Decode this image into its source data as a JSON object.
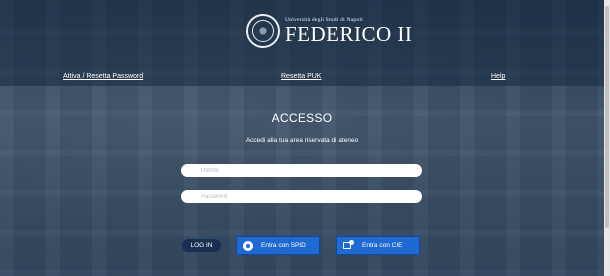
{
  "header": {
    "logo_subtitle": "Università degli Studi di Napoli",
    "logo_title": "FEDERICO II",
    "links": {
      "activate_reset": "Attiva / Resetta Password",
      "reset_puk": "Resetta PUK",
      "help": "Help"
    }
  },
  "main": {
    "title": "ACCESSO",
    "subtitle": "Accedi alla tua area riservata di ateneo",
    "username_placeholder": "Utente",
    "password_placeholder": "Password",
    "login_label": "LOG IN",
    "spid_label": "Entra con SPID",
    "cie_label": "Entra con CIE"
  },
  "colors": {
    "spid_button": "#1f6ad1",
    "login_button": "#16304e"
  },
  "icons": [
    "university-seal-icon",
    "spid-user-icon",
    "cie-card-icon"
  ]
}
